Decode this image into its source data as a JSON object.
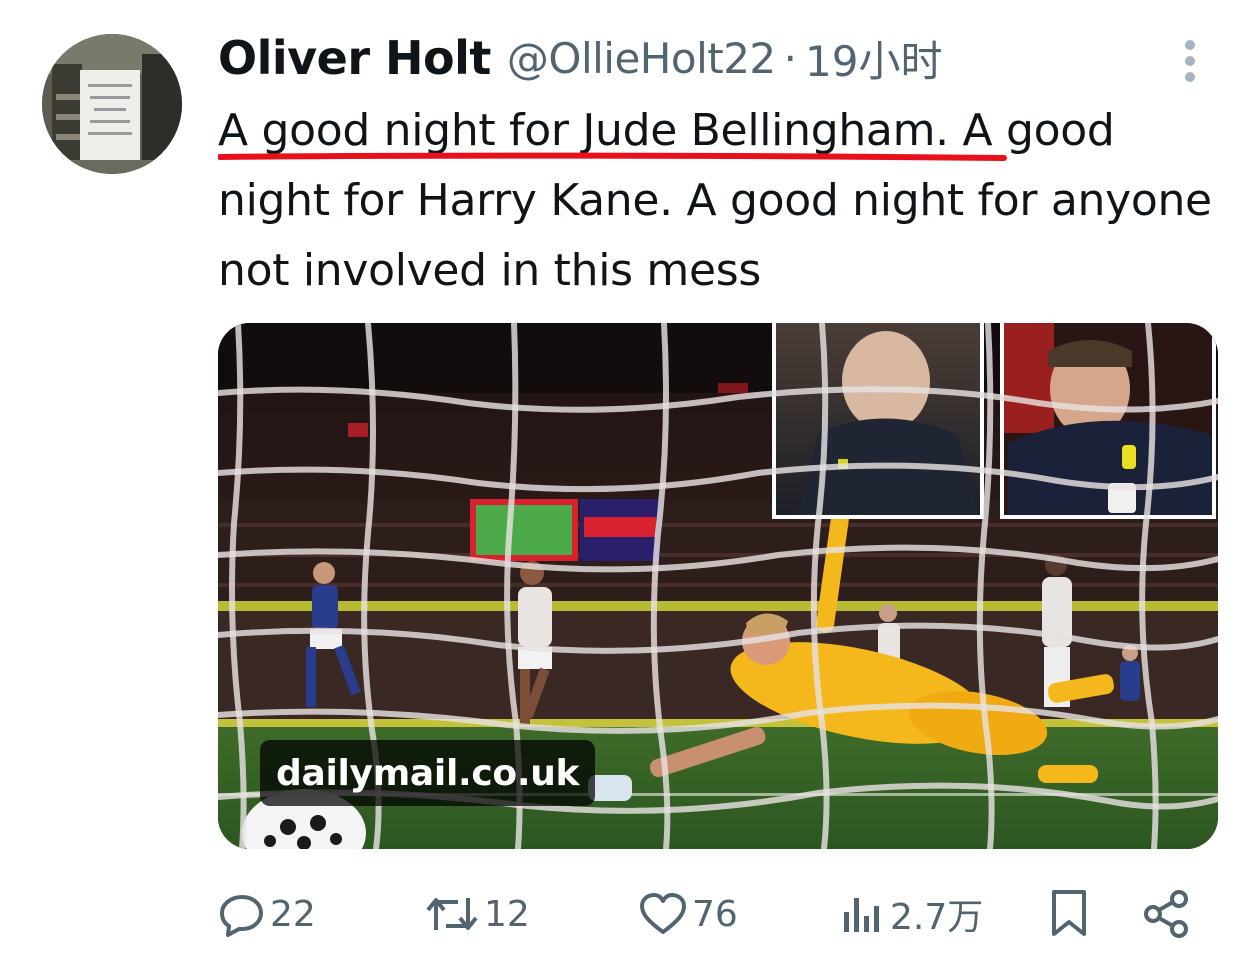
{
  "tweet": {
    "display_name": "Oliver Holt",
    "handle": "@OllieHolt22",
    "separator": "·",
    "time": "19小时",
    "text": "A good night for Jude Bellingham. A good night for Harry Kane. A good night for anyone not involved in this mess"
  },
  "media": {
    "source": "dailymail.co.uk"
  },
  "actions": {
    "replies": "22",
    "retweets": "12",
    "likes": "76",
    "views": "2.7万"
  },
  "icons": {
    "reply": "reply-icon",
    "retweet": "retweet-icon",
    "like": "heart-icon",
    "views": "views-icon",
    "bookmark": "bookmark-icon",
    "share": "share-icon",
    "more": "more-vertical-icon"
  },
  "colors": {
    "text": "#0f1419",
    "secondary": "#536471",
    "underline": "#e8101b",
    "keeper_kit": "#f5b81c"
  }
}
